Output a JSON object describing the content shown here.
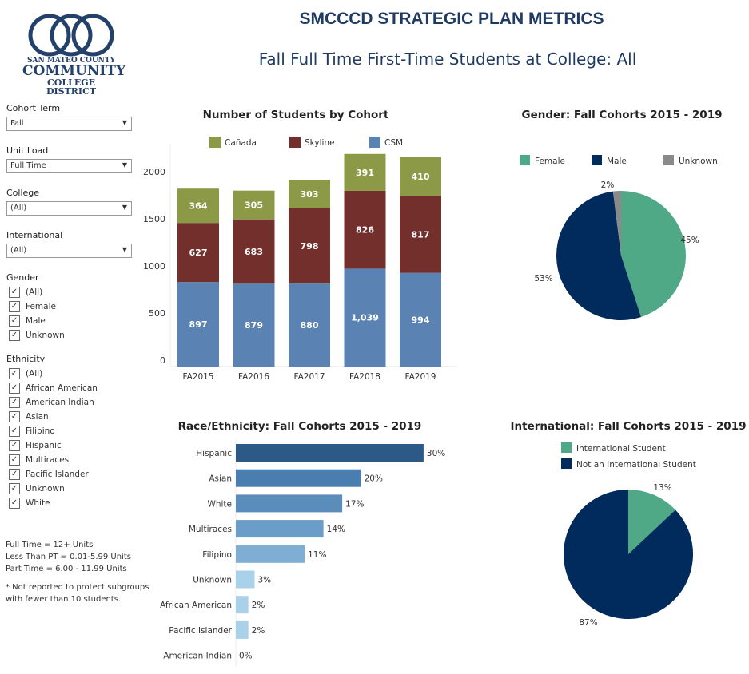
{
  "header": {
    "title": "SMCCCD STRATEGIC PLAN METRICS",
    "subtitle": "Fall Full Time First-Time Students at College: All",
    "logo_text": [
      "SAN MATEO COUNTY",
      "COMMUNITY",
      "COLLEGE DISTRICT"
    ]
  },
  "filters": {
    "cohort_term": {
      "label": "Cohort Term",
      "value": "Fall"
    },
    "unit_load": {
      "label": "Unit Load",
      "value": "Full Time"
    },
    "college": {
      "label": "College",
      "value": "(All)"
    },
    "international": {
      "label": "International",
      "value": "(All)"
    },
    "gender": {
      "label": "Gender",
      "items": [
        "(All)",
        "Female",
        "Male",
        "Unknown"
      ]
    },
    "ethnicity": {
      "label": "Ethnicity",
      "items": [
        "(All)",
        "African American",
        "American Indian",
        "Asian",
        "Filipino",
        "Hispanic",
        "Multiraces",
        "Pacific Islander",
        "Unknown",
        "White"
      ]
    }
  },
  "notes": {
    "lines": [
      "Full Time = 12+ Units",
      "Less Than PT = 0.01-5.99 Units",
      "Part Time = 6.00 - 11.99 Units"
    ],
    "footnote": [
      "* Not reported to protect subgroups",
      "with fewer than 10 students."
    ]
  },
  "chart_data": [
    {
      "type": "bar",
      "stacked": true,
      "title": "Number of Students by Cohort",
      "categories": [
        "FA2015",
        "FA2016",
        "FA2017",
        "FA2018",
        "FA2019"
      ],
      "yticks": [
        "0",
        "500",
        "1000",
        "1500",
        "2000"
      ],
      "ylim": [
        0,
        2300
      ],
      "legend": "top",
      "series": [
        {
          "name": "CSM",
          "color": "#5a82b3",
          "values": [
            897,
            879,
            880,
            1039,
            994
          ],
          "labels": [
            "897",
            "879",
            "880",
            "1,039",
            "994"
          ]
        },
        {
          "name": "Skyline",
          "color": "#722f2c",
          "values": [
            627,
            683,
            798,
            826,
            817
          ],
          "labels": [
            "627",
            "683",
            "798",
            "826",
            "817"
          ]
        },
        {
          "name": "Cañada",
          "color": "#8c9a48",
          "values": [
            364,
            305,
            303,
            391,
            410
          ],
          "labels": [
            "364",
            "305",
            "303",
            "391",
            "410"
          ]
        }
      ]
    },
    {
      "type": "pie",
      "title": "Gender: Fall Cohorts 2015 - 2019",
      "legend": "top",
      "slices": [
        {
          "name": "Female",
          "value": 45,
          "label": "45%",
          "color": "#4fa987"
        },
        {
          "name": "Male",
          "value": 53,
          "label": "53%",
          "color": "#002b5c"
        },
        {
          "name": "Unknown",
          "value": 2,
          "label": "2%",
          "color": "#8a8a8a"
        }
      ]
    },
    {
      "type": "bar",
      "orientation": "horizontal",
      "title": "Race/Ethnicity: Fall Cohorts 2015 - 2019",
      "categories": [
        "Hispanic",
        "Asian",
        "White",
        "Multiraces",
        "Filipino",
        "Unknown",
        "African American",
        "Pacific Islander",
        "American Indian"
      ],
      "values": [
        30,
        20,
        17,
        14,
        11,
        3,
        2,
        2,
        0
      ],
      "labels": [
        "30%",
        "20%",
        "17%",
        "14%",
        "11%",
        "3%",
        "2%",
        "2%",
        "0%"
      ],
      "colors": [
        "#2c5985",
        "#4a7db0",
        "#5a8cbc",
        "#6a9dc8",
        "#7eaed4",
        "#a9d1ea",
        "#a9d1ea",
        "#a9d1ea",
        "#a9d1ea"
      ]
    },
    {
      "type": "pie",
      "title": "International: Fall Cohorts 2015 - 2019",
      "legend": "top",
      "slices": [
        {
          "name": "International Student",
          "value": 13,
          "label": "13%",
          "color": "#4fa987"
        },
        {
          "name": "Not an International Student",
          "value": 87,
          "label": "87%",
          "color": "#002b5c"
        }
      ]
    }
  ]
}
